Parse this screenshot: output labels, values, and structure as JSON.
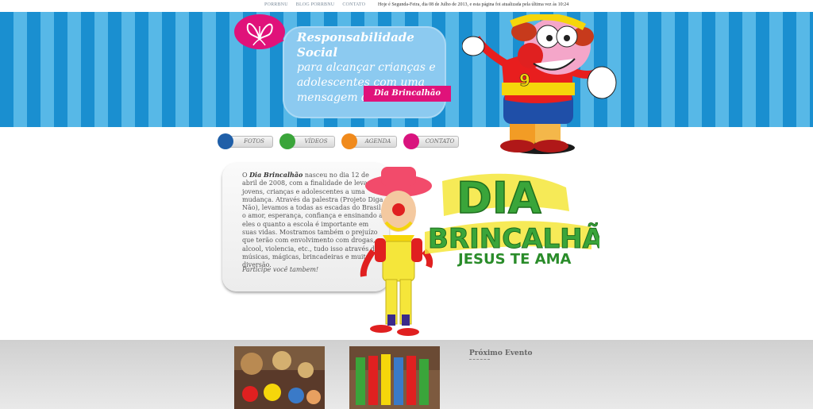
{
  "topnav": {
    "items": [
      "PORRBNU",
      "BLOG PORRBNU",
      "CONTATO"
    ],
    "note": "Hoje é Segunda-Feira, dia 08 de Julho de 2013, e esta página foi atualizada pela última vez às 10:24"
  },
  "banner": {
    "headline": "Responsabilidade Social",
    "text": "para alcançar crianças e adolescentes com uma mensagem de amor.",
    "ribbon": "Dia Brincalhão",
    "clown_shirt_number": "9"
  },
  "nav": {
    "items": [
      {
        "label": "FOTOS",
        "color": "#1f5fa8"
      },
      {
        "label": "VÍDEOS",
        "color": "#3aa53a"
      },
      {
        "label": "AGENDA",
        "color": "#f08a1c"
      },
      {
        "label": "CONTATO",
        "color": "#d9137e"
      }
    ]
  },
  "about": {
    "intro_prefix": "O ",
    "brand": "Dia Brincalhão",
    "body": " nasceu no dia 12 de abril de 2008, com a finalidade de levar jovens, crianças e adolescentes a uma mudança. Através da palestra (Projeto Diga Não), levamos a todas as escadas do Brasil, o amor, esperança, confiança e ensinando a eles o quanto a escola é importante em suas vidas. Mostramos também o prejuízo que terão com envolvimento com drogas, alcool, violencia, etc., tudo isso através de músicas, mágicas, brincadeiras e muita diversão.",
    "cta": "Participe você tambem!"
  },
  "logo": {
    "line1": "DIA",
    "line2": "BRINCALHÃO",
    "line3": "JESUS TE AMA"
  },
  "footer": {
    "event_title": "Próximo Evento"
  }
}
